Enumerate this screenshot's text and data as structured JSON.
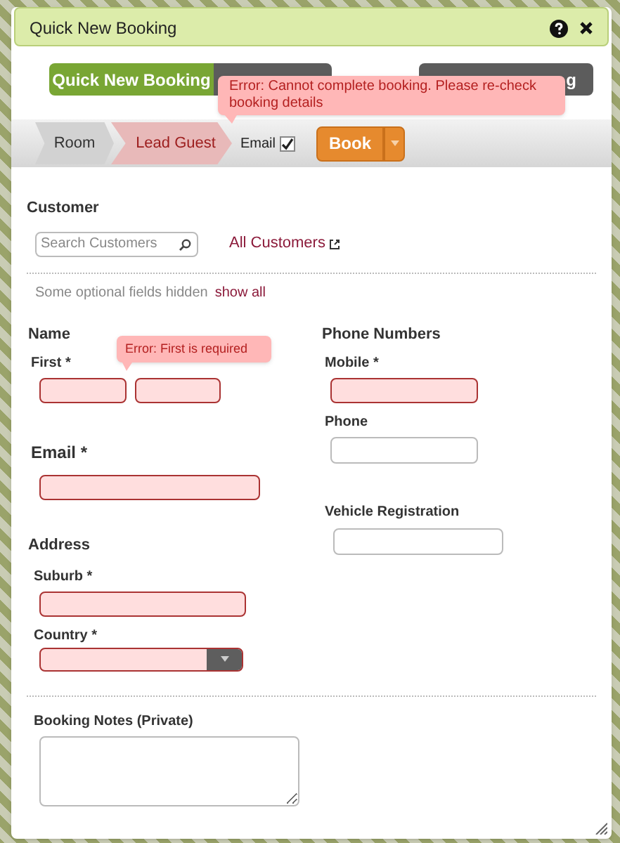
{
  "dialog": {
    "title": "Quick New Booking"
  },
  "tabs": [
    {
      "label": "Quick New Booking",
      "selected": true
    },
    {
      "selected": false
    },
    {
      "label": "g",
      "selected": false
    }
  ],
  "error_message": "Error: Cannot complete booking. Please re-check booking details",
  "steps": [
    {
      "label": "Room",
      "selected": false
    },
    {
      "label": "Lead Guest",
      "selected": true
    }
  ],
  "email_option": {
    "label": "Email",
    "checked": true
  },
  "book_button": "Book",
  "customer": {
    "heading": "Customer",
    "search_placeholder": "Search Customers",
    "link": "All Customers"
  },
  "optional_note": {
    "text": "Some optional fields hidden",
    "link": "show all"
  },
  "name": {
    "heading": "Name",
    "label": "First *",
    "error": "Error: First is required",
    "fields": [
      {
        "invalid": true
      },
      {
        "invalid": true
      }
    ]
  },
  "email": {
    "label": "Email *",
    "invalid": true
  },
  "address": {
    "heading": "Address",
    "fields": [
      {
        "kind": "text",
        "label": "Suburb *",
        "invalid": true
      },
      {
        "kind": "select",
        "label": "Country *",
        "invalid": true
      }
    ]
  },
  "phone_numbers": {
    "heading": "Phone Numbers",
    "fields": [
      {
        "label": "Mobile *",
        "invalid": true
      },
      {
        "label": "Phone",
        "invalid": false
      }
    ]
  },
  "vehicle_registration": {
    "label": "Vehicle Registration",
    "invalid": false
  },
  "booking_notes": {
    "label": "Booking Notes (Private)"
  }
}
